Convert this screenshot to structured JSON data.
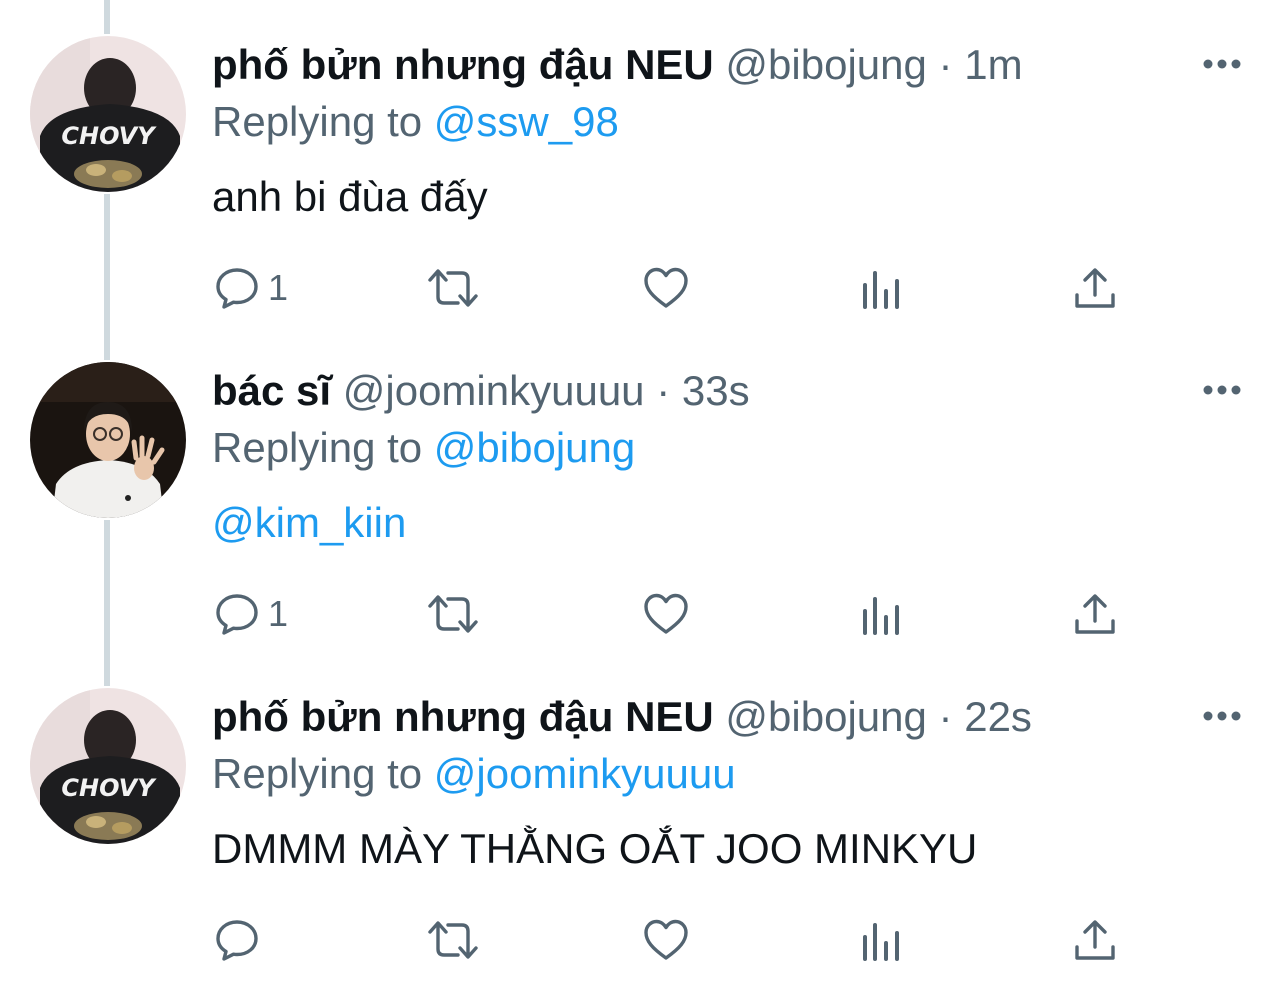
{
  "tweets": [
    {
      "display_name": "phố bửn nhưng đậu NEU",
      "handle": "@bibojung",
      "separator": "·",
      "time": "1m",
      "replying_prefix": "Replying to",
      "replying_handle": "@ssw_98",
      "text": "anh bi đùa đấy",
      "reply_count": "1",
      "avatar_shirt_text": "CHOVY"
    },
    {
      "display_name": "bác sĩ",
      "handle": "@joominkyuuuu",
      "separator": "·",
      "time": "33s",
      "replying_prefix": "Replying to",
      "replying_handle": "@bibojung",
      "text": "@kim_kiin",
      "reply_count": "1"
    },
    {
      "display_name": "phố bửn nhưng đậu NEU",
      "handle": "@bibojung",
      "separator": "·",
      "time": "22s",
      "replying_prefix": "Replying to",
      "replying_handle": "@joominkyuuuu",
      "text": "DMMM MÀY THẰNG OẮT JOO MINKYU",
      "reply_count": "",
      "avatar_shirt_text": "CHOVY"
    }
  ],
  "icons": {
    "reply": "reply-icon",
    "retweet": "retweet-icon",
    "like": "heart-icon",
    "views": "views-icon",
    "share": "share-icon",
    "more": "more-icon"
  },
  "colors": {
    "link": "#1d9bf0",
    "secondary": "#536471",
    "primary": "#0f1419",
    "thread_line": "#cfd9de"
  }
}
